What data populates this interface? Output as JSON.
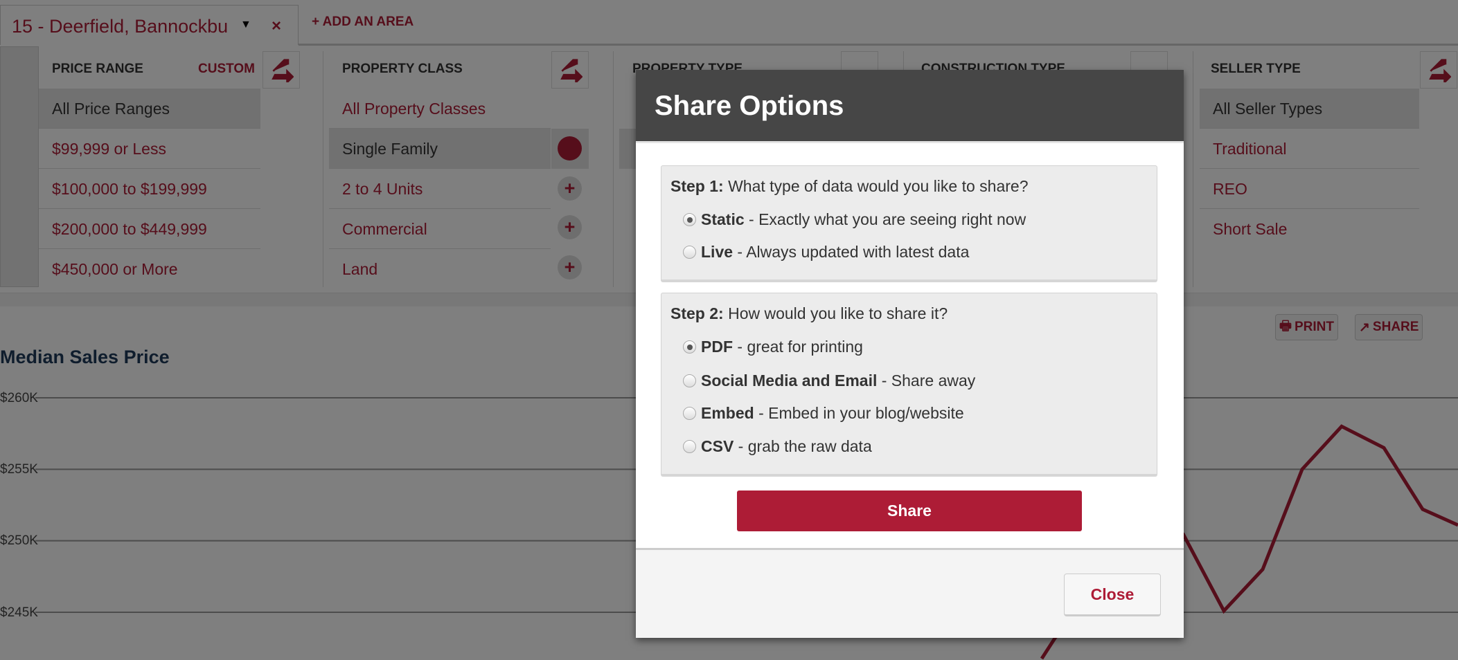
{
  "area_tab": {
    "label": "15 - Deerfield, Bannockbu",
    "add_area": "+ ADD AN AREA",
    "close_symbol": "×"
  },
  "filters": [
    {
      "header": "PRICE RANGE",
      "extra": "CUSTOM",
      "items": [
        "All Price Ranges",
        "$99,999 or Less",
        "$100,000 to $199,999",
        "$200,000 to $449,999",
        "$450,000 or More"
      ],
      "selected": 0
    },
    {
      "header": "PROPERTY CLASS",
      "items": [
        "All Property Classes",
        "Single Family",
        "2 to 4 Units",
        "Commercial",
        "Land"
      ],
      "selected": 1
    },
    {
      "header": "PROPERTY TYPE"
    },
    {
      "header": "CONSTRUCTION TYPE"
    },
    {
      "header": "SELLER TYPE",
      "items": [
        "All Seller Types",
        "Traditional",
        "REO",
        "Short Sale"
      ],
      "selected": 0
    }
  ],
  "chart_toolbar": {
    "print": "PRINT",
    "share": "SHARE"
  },
  "chart_data": {
    "type": "line",
    "title": "Median Sales Price",
    "y_ticks": [
      "$260K",
      "$255K",
      "$250K",
      "$245K"
    ],
    "ylim": [
      245000,
      260000
    ],
    "grid": true,
    "color": "#ad1c36",
    "visible_values": [
      250400,
      245100,
      248000,
      255000,
      258000,
      256500,
      252200,
      251100
    ]
  },
  "modal": {
    "title": "Share Options",
    "step1": {
      "label": "Step 1:",
      "question": "What type of data would you like to share?",
      "options": [
        {
          "name": "Static",
          "desc": " - Exactly what you are seeing right now",
          "checked": true
        },
        {
          "name": "Live",
          "desc": " - Always updated with latest data",
          "checked": false
        }
      ]
    },
    "step2": {
      "label": "Step 2:",
      "question": "How would you like to share it?",
      "options": [
        {
          "name": "PDF",
          "desc": " - great for printing",
          "checked": true
        },
        {
          "name": "Social Media and Email",
          "desc": " - Share away",
          "checked": false
        },
        {
          "name": "Embed",
          "desc": " - Embed in your blog/website",
          "checked": false
        },
        {
          "name": "CSV",
          "desc": " - grab the raw data",
          "checked": false
        }
      ]
    },
    "share_button": "Share",
    "close_button": "Close"
  },
  "colors": {
    "accent": "#ad1c36",
    "modal_header": "#464646"
  }
}
